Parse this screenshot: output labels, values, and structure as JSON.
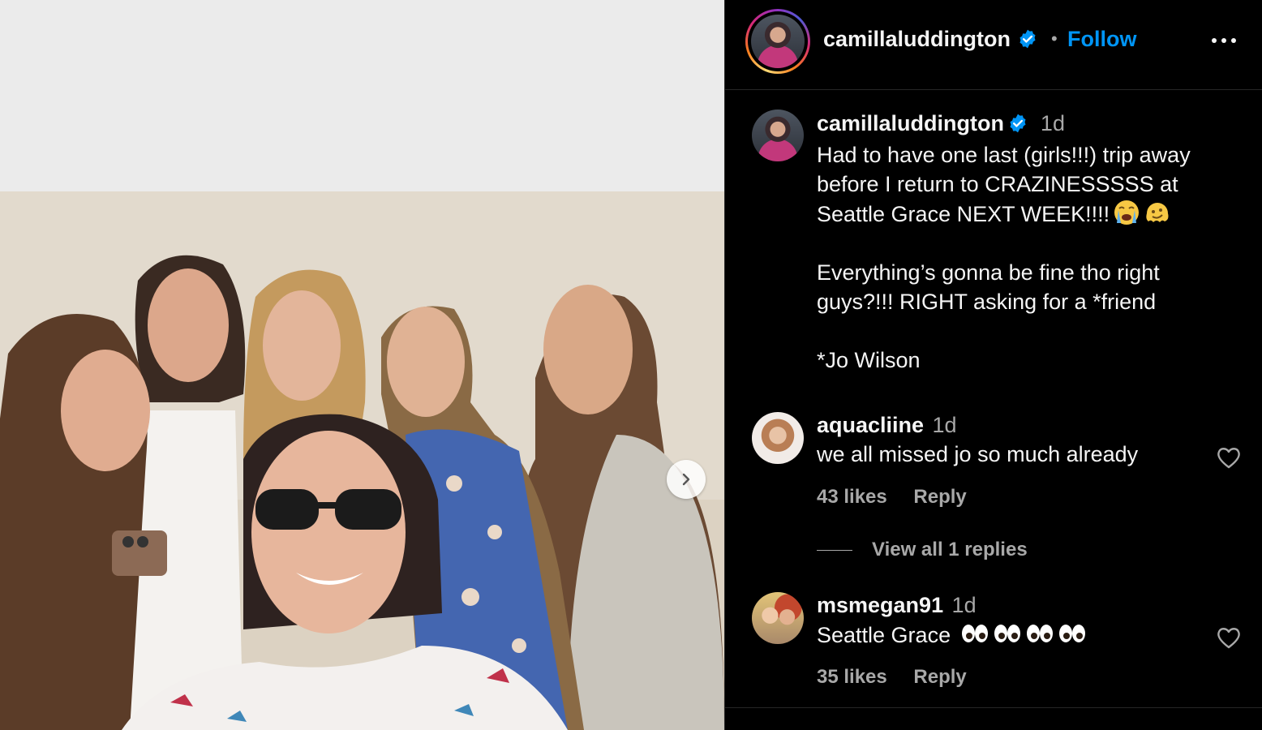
{
  "post": {
    "media": {
      "next_icon": "chevron-right-icon"
    },
    "header": {
      "username": "camillaluddington",
      "separator": "•",
      "follow_label": "Follow",
      "more_icon": "more-horizontal-icon",
      "verified_icon": "verified-badge-icon"
    },
    "caption": {
      "username": "camillaluddington",
      "time": "1d",
      "lines": [
        "Had to have one last (girls!!!) trip away before I return to CRAZINESSSSS at Seattle Grace NEXT WEEK!!!!",
        "Everything’s gonna be fine tho right guys?!!! RIGHT asking for a *friend",
        "*Jo Wilson"
      ],
      "emojis": [
        "loudly-crying-face",
        "melting-face"
      ]
    },
    "comments": [
      {
        "username": "aquacliine",
        "time": "1d",
        "text": "we all missed jo so much already",
        "likes": "43 likes",
        "reply_label": "Reply",
        "view_replies": "View all 1 replies"
      },
      {
        "username": "msmegan91",
        "time": "1d",
        "text": "Seattle Grace",
        "emojis": [
          "eyes",
          "eyes",
          "eyes",
          "eyes"
        ],
        "likes": "35 likes",
        "reply_label": "Reply"
      }
    ]
  },
  "colors": {
    "background": "#000000",
    "primary_text": "#f5f5f5",
    "secondary_text": "#a8a8a8",
    "link_blue": "#0095f6",
    "divider": "#262626"
  }
}
